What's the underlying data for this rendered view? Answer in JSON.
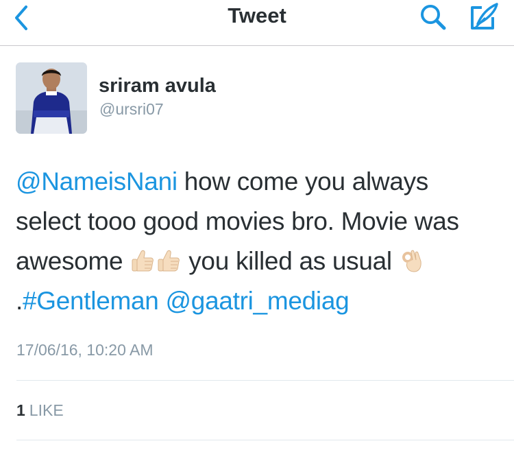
{
  "header": {
    "title": "Tweet",
    "back_icon": "chevron-left-icon",
    "search_icon": "search-icon",
    "compose_icon": "compose-icon",
    "accent_color": "#1b95e0"
  },
  "tweet": {
    "author": {
      "display_name": "sriram avula",
      "handle": "@ursri07"
    },
    "text": {
      "mention_1": "@NameisNani",
      "part_1": " how come you always select tooo good movies bro. Movie was awesome ",
      "part_2": " you killed as usual ",
      "part_3": ".",
      "hashtag": "#Gentleman",
      "space": " ",
      "mention_2": "@gaatri_mediag"
    },
    "emojis": [
      "thumbs-up-icon",
      "thumbs-up-icon",
      "ok-hand-icon"
    ],
    "timestamp": "17/06/16, 10:20 AM",
    "likes": {
      "count": "1",
      "label": "LIKE"
    }
  }
}
